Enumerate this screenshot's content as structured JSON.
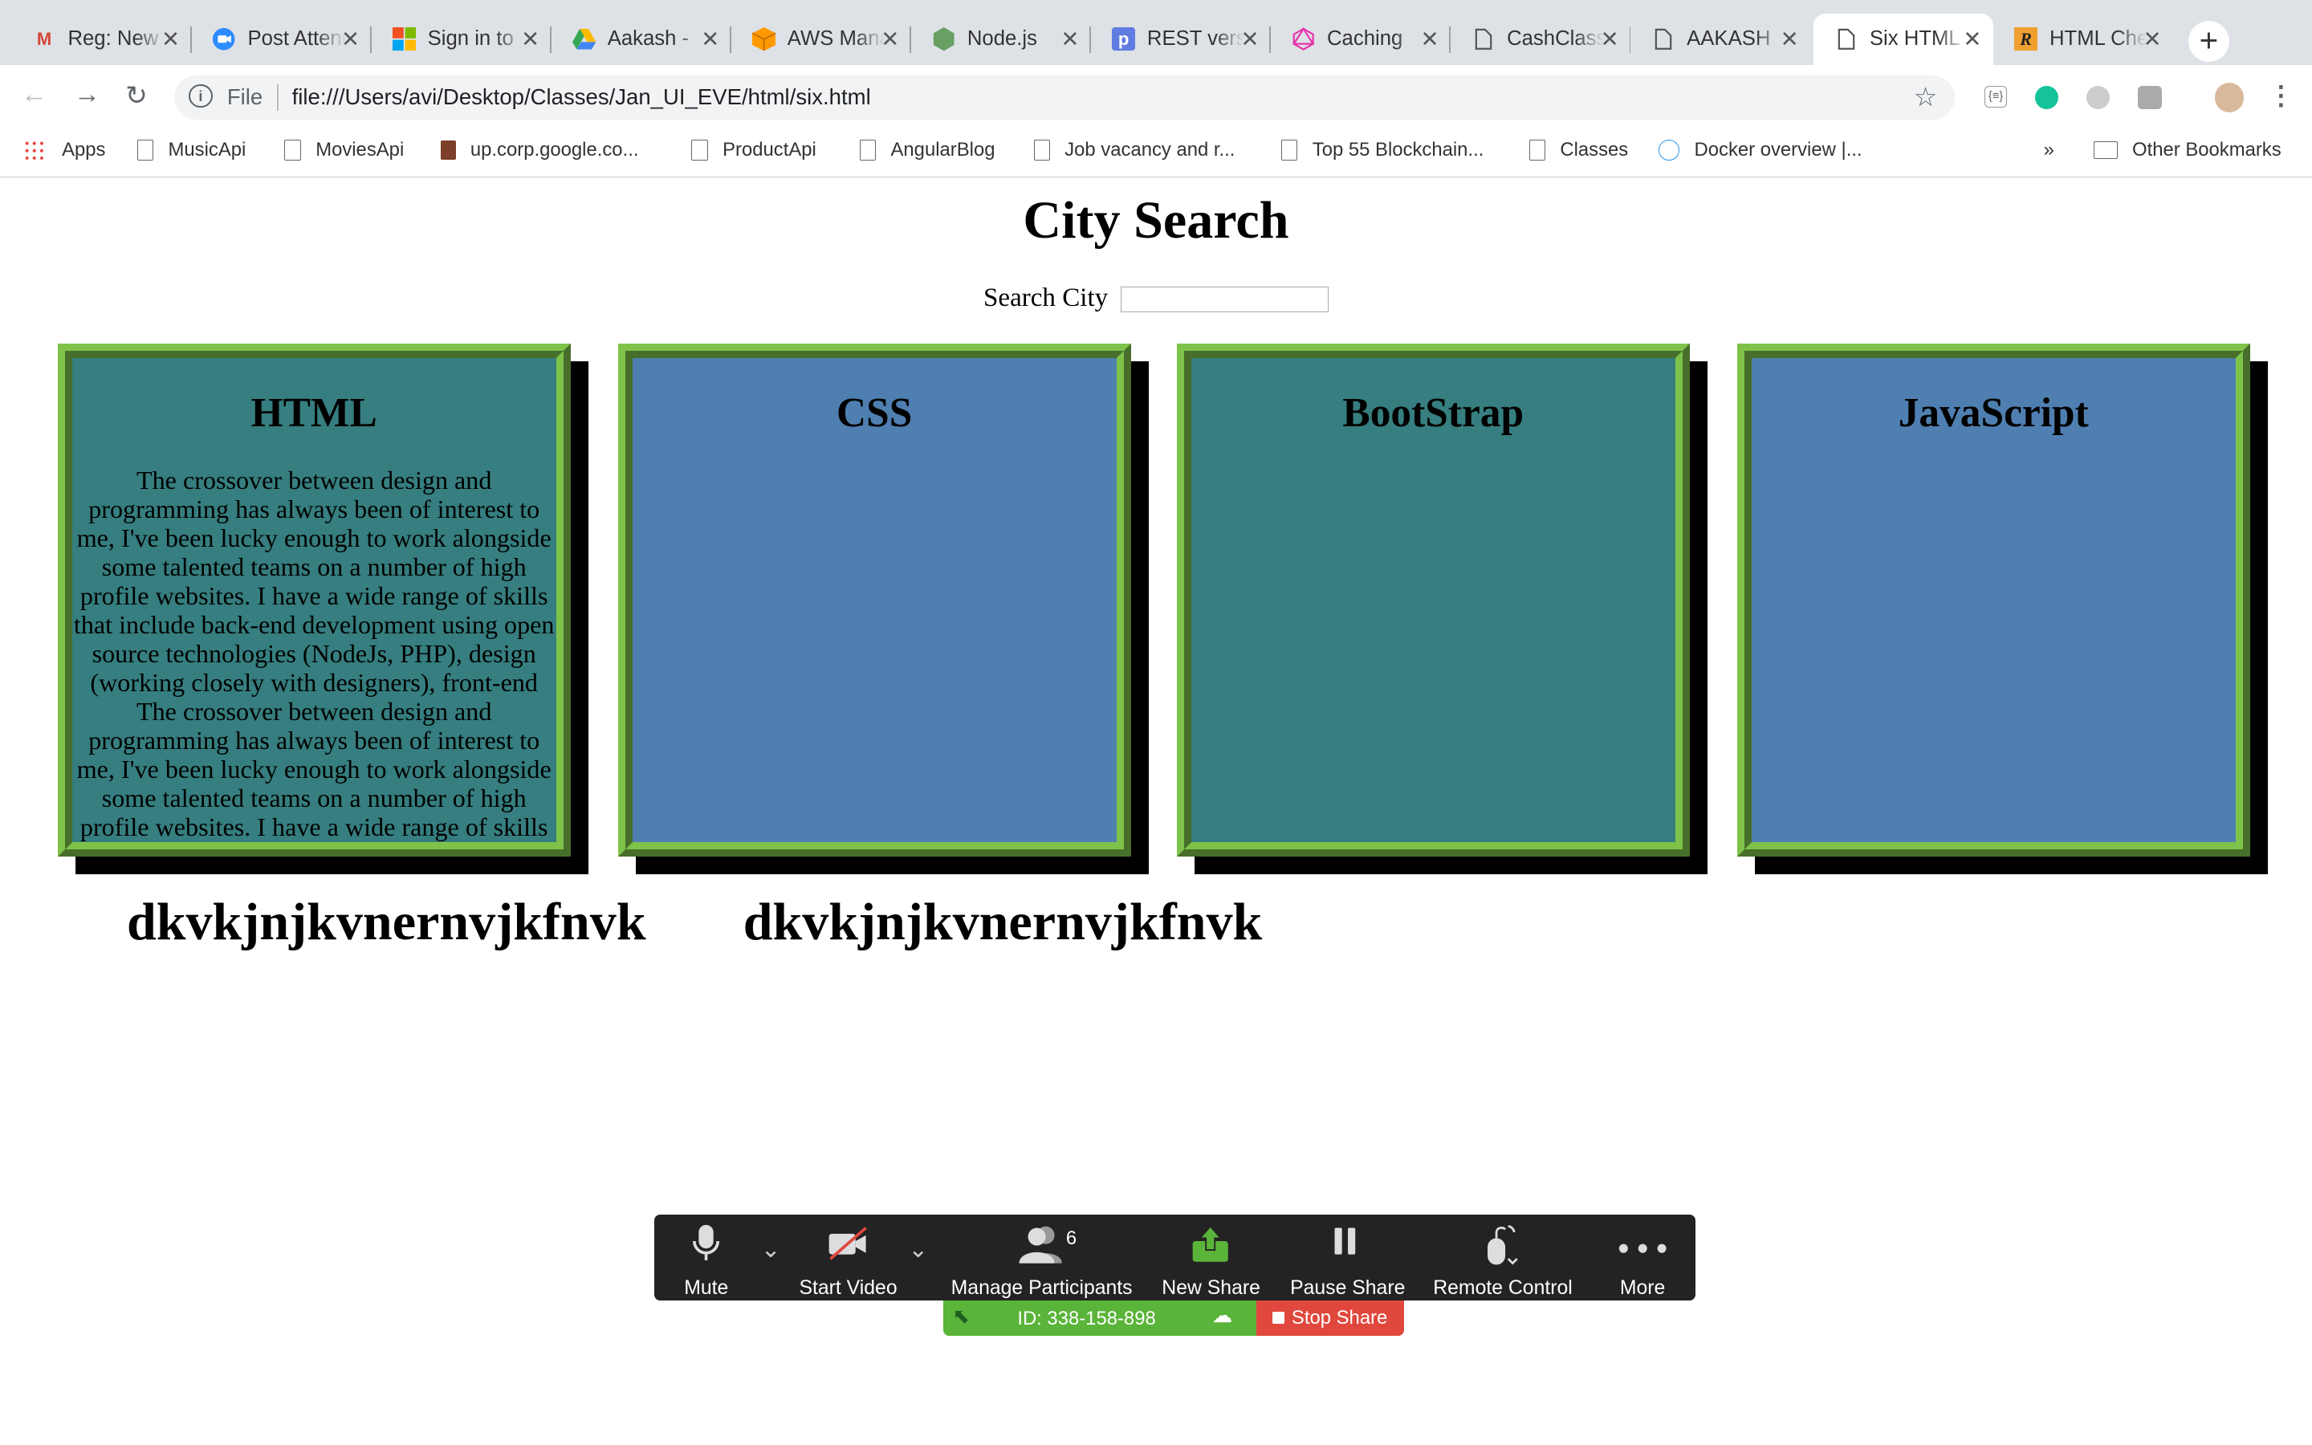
{
  "tabs": [
    {
      "title": "Reg: New",
      "icon": "gmail-icon",
      "color": "#d44638"
    },
    {
      "title": "Post Attendee",
      "icon": "zoom-icon",
      "color": "#2d8cff"
    },
    {
      "title": "Sign in to",
      "icon": "microsoft-icon",
      "color": "#f25022"
    },
    {
      "title": "Aakash -",
      "icon": "drive-icon",
      "color": "#34a853"
    },
    {
      "title": "AWS Management",
      "icon": "aws-icon",
      "color": "#f90"
    },
    {
      "title": "Node.js",
      "icon": "nodejs-icon",
      "color": "#689f63"
    },
    {
      "title": "REST versus",
      "icon": "p-icon",
      "color": "#3b7ddd"
    },
    {
      "title": "Caching",
      "icon": "graphql-icon",
      "color": "#e535ab"
    },
    {
      "title": "CashClass",
      "icon": "file-icon",
      "color": "#666"
    },
    {
      "title": "AAKASH",
      "icon": "file-icon",
      "color": "#666"
    },
    {
      "title": "Six HTML",
      "icon": "file-icon",
      "color": "#666"
    },
    {
      "title": "HTML Cheat",
      "icon": "r-icon",
      "color": "#f0a030"
    }
  ],
  "address": {
    "label": "File",
    "url": "file:///Users/avi/Desktop/Classes/Jan_UI_EVE/html/six.html"
  },
  "bookmarks": [
    "Apps",
    "MusicApi",
    "MoviesApi",
    "up.corp.google.co...",
    "ProductApi",
    "AngularBlog",
    "Job vacancy and r...",
    "Top 55 Blockchain...",
    "Classes",
    "Docker overview |..."
  ],
  "bookmarks_more": "»",
  "other_bookmarks": "Other Bookmarks",
  "page": {
    "title": "City Search",
    "search_label": "Search City",
    "search_value": "",
    "cards": [
      {
        "title": "HTML",
        "body": "The crossover between design and programming has always been of interest to me, I've been lucky enough to work alongside some talented teams on a number of high profile websites. I have a wide range of skills that include back-end development using open source technologies (NodeJs, PHP), design (working closely with designers), front-end The crossover between design and programming has always been of interest to me, I've been lucky enough to work alongside some talented teams on a number of high profile websites. I have a wide range of skills that include back-end development"
      },
      {
        "title": "CSS",
        "body": ""
      },
      {
        "title": "BootStrap",
        "body": ""
      },
      {
        "title": "JavaScript",
        "body": ""
      }
    ],
    "headings": [
      "dkvkjnjkvnernvjkfnvk",
      "dkvkjnjkvnernvjkfnvk"
    ]
  },
  "zoom": {
    "mute": "Mute",
    "start_video": "Start Video",
    "manage_participants": "Manage Participants",
    "participant_count": "6",
    "new_share": "New Share",
    "pause_share": "Pause Share",
    "remote_control": "Remote Control",
    "more": "More",
    "meeting_id": "ID: 338-158-898",
    "stop_share": "Stop Share"
  }
}
